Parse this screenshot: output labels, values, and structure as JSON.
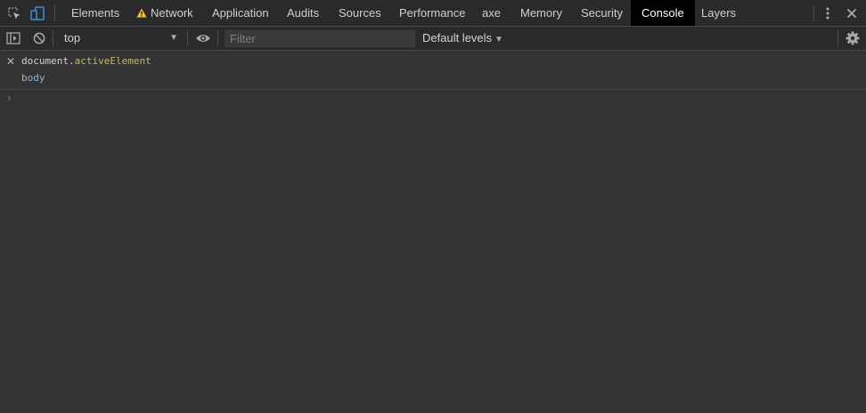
{
  "devtools": {
    "tabs": [
      {
        "label": "Elements"
      },
      {
        "label": "Network",
        "warning": true
      },
      {
        "label": "Application"
      },
      {
        "label": "Audits"
      },
      {
        "label": "Sources"
      },
      {
        "label": "Performance"
      },
      {
        "label": "axe"
      },
      {
        "label": "Memory"
      },
      {
        "label": "Security"
      },
      {
        "label": "Console",
        "active": true
      },
      {
        "label": "Layers"
      }
    ],
    "icons": {
      "inspect": "inspect-element-icon",
      "device": "device-toolbar-icon",
      "more": "more-options-icon",
      "close": "close-icon",
      "sidebar": "show-sidebar-icon",
      "clear": "clear-console-icon",
      "eye": "live-expression-eye-icon",
      "settings": "gear-icon"
    }
  },
  "toolbar": {
    "context": "top",
    "filter_placeholder": "Filter",
    "levels": "Default levels"
  },
  "console": {
    "entry": {
      "object": "document",
      "dot": ".",
      "property": "activeElement",
      "result": "body"
    },
    "prompt_symbol": "›"
  },
  "colors": {
    "background": "#333333",
    "toolbar": "#2a2a2a",
    "active_tab": "#000000",
    "property": "#c3b672",
    "result": "#86b8dc",
    "prompt": "#3f8ddc"
  }
}
